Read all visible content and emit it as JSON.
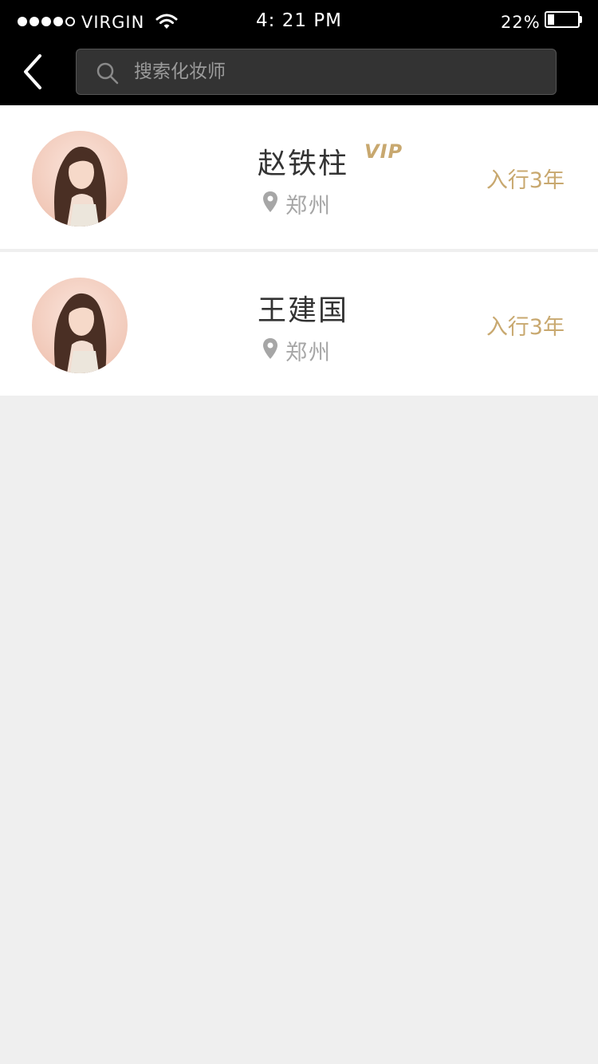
{
  "status_bar": {
    "carrier": "VIRGIN",
    "time": "4: 21 PM",
    "battery": "22%",
    "battery_level": 0.22,
    "signal_bars_filled": 4
  },
  "nav": {
    "back_icon": "chevron-left-icon",
    "search_icon": "search-icon",
    "search_placeholder": "搜索化妆师",
    "search_value": ""
  },
  "artists": [
    {
      "name": "赵铁柱",
      "badge": "VIP",
      "location": "郑州",
      "experience": "入行3年",
      "avatar": "avatar-woman-long-hair"
    },
    {
      "name": "王建国",
      "badge": "",
      "location": "郑州",
      "experience": "入行3年",
      "avatar": "avatar-woman-long-hair"
    }
  ],
  "colors": {
    "header_bg": "#000000",
    "accent_gold": "#c8a86f",
    "page_bg": "#efefef",
    "name_text": "#333333",
    "location_text": "#a6a6a6"
  }
}
